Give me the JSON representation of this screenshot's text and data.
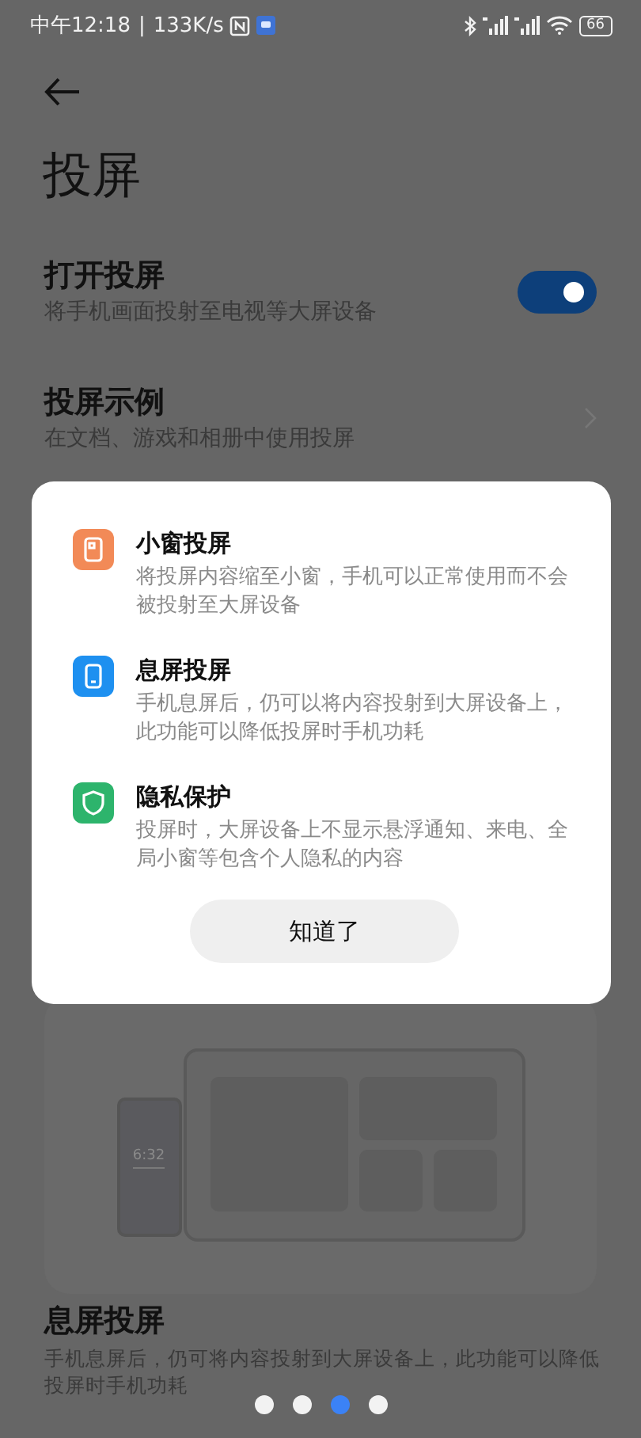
{
  "status_bar": {
    "time": "中午12:18",
    "separator": "|",
    "speed": "133K/s",
    "battery": "66"
  },
  "page": {
    "title": "投屏"
  },
  "settings": [
    {
      "kind": "toggle",
      "title": "打开投屏",
      "subtitle": "将手机画面投射至电视等大屏设备",
      "on": true
    },
    {
      "kind": "link",
      "title": "投屏示例",
      "subtitle": "在文档、游戏和相册中使用投屏"
    }
  ],
  "example": {
    "screen_time": "6:32",
    "title": "息屏投屏",
    "description": "手机息屏后，仍可将内容投射到大屏设备上，此功能可以降低投屏时手机功耗"
  },
  "carousel_dots": [
    {
      "selected": false
    },
    {
      "selected": false
    },
    {
      "selected": true
    },
    {
      "selected": false
    }
  ],
  "dialog": {
    "features": [
      {
        "kind": "window",
        "color": "#f28a57",
        "title": "小窗投屏",
        "description": "将投屏内容缩至小窗，手机可以正常使用而不会被投射至大屏设备"
      },
      {
        "kind": "phone",
        "color": "#1e90f0",
        "title": "息屏投屏",
        "description": "手机息屏后，仍可以将内容投射到大屏设备上，此功能可以降低投屏时手机功耗"
      },
      {
        "kind": "shield",
        "color": "#2db46c",
        "title": "隐私保护",
        "description": "投屏时，大屏设备上不显示悬浮通知、来电、全局小窗等包含个人隐私的内容"
      }
    ],
    "button": "知道了"
  }
}
